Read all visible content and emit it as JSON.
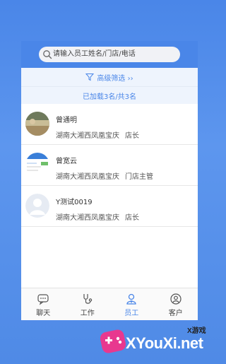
{
  "search": {
    "placeholder": "请输入员工姓名/门店/电话"
  },
  "filter": {
    "label": "高级筛选 ››"
  },
  "status": {
    "loaded": "已加载3名/共3名"
  },
  "employees": [
    {
      "name": "曾通明",
      "store": "湖南大湘西凤凰宝庆",
      "title": "店长"
    },
    {
      "name": "曾宽云",
      "store": "湖南大湘西凤凰宝庆",
      "title": "门店主管"
    },
    {
      "name": "Y测试0019",
      "store": "湖南大湘西凤凰宝庆",
      "title": "店长"
    }
  ],
  "tabs": [
    {
      "label": "聊天",
      "icon": "chat-icon"
    },
    {
      "label": "工作",
      "icon": "stethoscope-icon"
    },
    {
      "label": "员工",
      "icon": "person-icon",
      "active": true
    },
    {
      "label": "客户",
      "icon": "customer-icon"
    }
  ],
  "watermark": {
    "text": "XYouXi.net",
    "small": "X游戏"
  },
  "colors": {
    "accent": "#4a86e8",
    "background": "#4f8ae6"
  }
}
